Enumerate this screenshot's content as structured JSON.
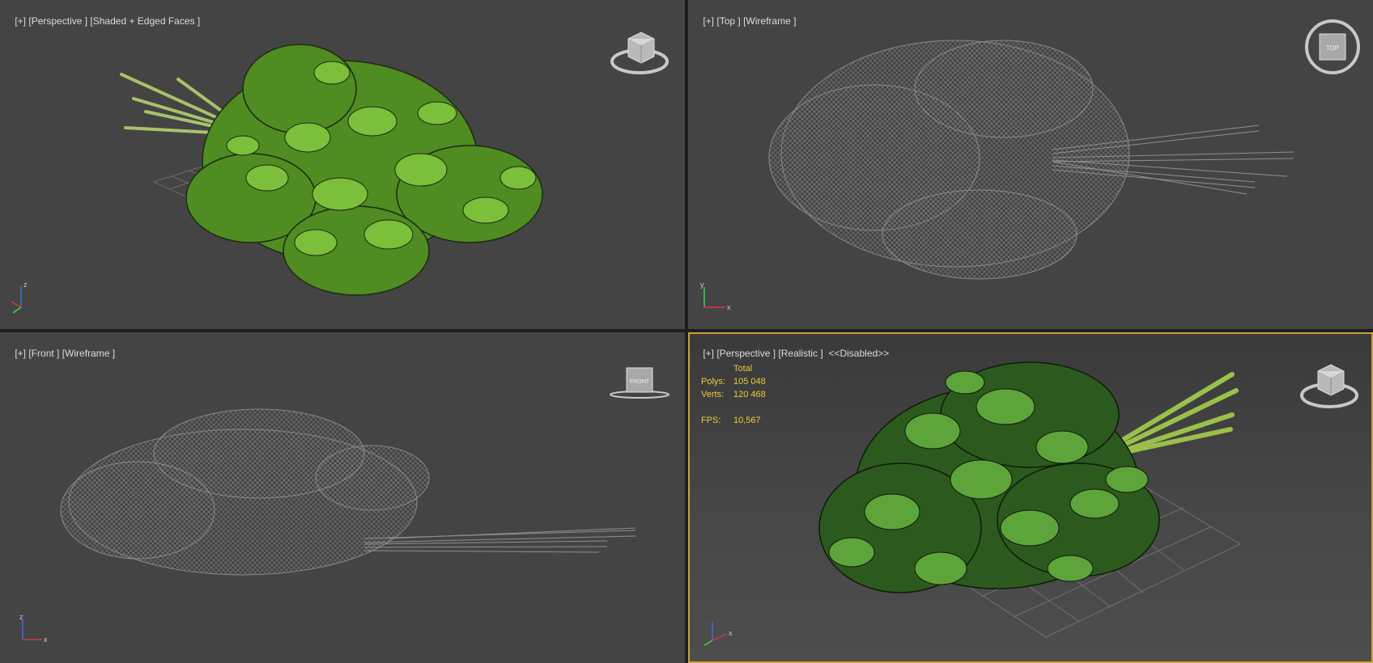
{
  "viewports": {
    "top_left": {
      "plus": "[+]",
      "view": "[Perspective ]",
      "shading": "[Shaded + Edged Faces ]"
    },
    "top_right": {
      "plus": "[+]",
      "view": "[Top ]",
      "shading": "[Wireframe ]"
    },
    "bottom_left": {
      "plus": "[+]",
      "view": "[Front ]",
      "shading": "[Wireframe ]"
    },
    "bottom_right": {
      "plus": "[+]",
      "view": "[Perspective ]",
      "shading": "[Realistic ]",
      "extra": "<<Disabled>>"
    }
  },
  "stats": {
    "total_label": "Total",
    "polys_label": "Polys:",
    "polys_value": "105 048",
    "verts_label": "Verts:",
    "verts_value": "120 468",
    "fps_label": "FPS:",
    "fps_value": "10,567"
  },
  "viewcubes": {
    "top": "TOP",
    "front": "FRONT"
  },
  "axes": {
    "x": "x",
    "y": "y",
    "z": "z"
  },
  "colors": {
    "viewport_bg": "#444444",
    "active_border": "#c8a23a",
    "stats_text": "#e8cc3a",
    "wire": "#8a8a8a",
    "leaf_green": "#5a9a2a"
  }
}
